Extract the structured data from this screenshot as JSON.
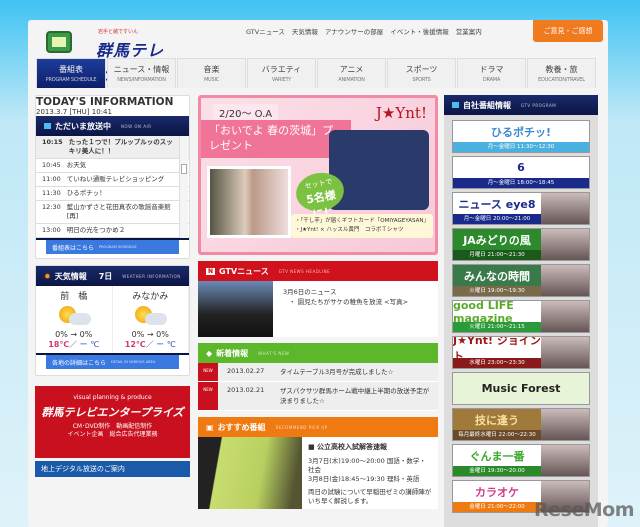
{
  "header": {
    "logo_tag": "岩手と緒ですいん",
    "logo": "群馬テレビ",
    "links": [
      "GTVニュース",
      "天気情報",
      "アナウンサーの部屋",
      "イベント・後援情報",
      "営業案内"
    ],
    "opinion": "ご意見・ご感想"
  },
  "nav": [
    {
      "label": "番組表",
      "sub": "PROGRAM SCHEDULE"
    },
    {
      "label": "ニュース・情報",
      "sub": "NEWS/INFORMATION"
    },
    {
      "label": "音楽",
      "sub": "MUSIC"
    },
    {
      "label": "バラエティ",
      "sub": "VARIETY"
    },
    {
      "label": "アニメ",
      "sub": "ANIMATION"
    },
    {
      "label": "スポーツ",
      "sub": "SPORTS"
    },
    {
      "label": "ドラマ",
      "sub": "DRAMA"
    },
    {
      "label": "教養・旅",
      "sub": "EDUCATION/TRAVEL"
    }
  ],
  "today": {
    "title": "TODAY'S INFORMATION",
    "date": "2013.3.7 [THU] 10:41"
  },
  "onair": {
    "title": "ただいま放送中",
    "sub": "NOW ON AIR",
    "rows": [
      {
        "time": "10:15",
        "title": "たった１つで！プルップルッのスッキリ美人に！！"
      },
      {
        "time": "10:45",
        "title": "お天気"
      },
      {
        "time": "11:00",
        "title": "ていねい通販テレビショッピング"
      },
      {
        "time": "11:30",
        "title": "ひるポチッ！"
      },
      {
        "time": "12:30",
        "title": "藍山かずさと花田真衣の歌謡音楽館[再]"
      },
      {
        "time": "13:00",
        "title": "明日の光をつかめ２"
      }
    ],
    "more": "番組表はこちら",
    "more_sub": "PROGRAM SCHEDULE"
  },
  "weather": {
    "title": "天気情報",
    "day": "7日",
    "sub": "WEATHER INFORMATION",
    "cities": [
      {
        "name": "前　橋",
        "pct": "0% → 0%",
        "hi": "18℃",
        "lo": "／ ー ℃"
      },
      {
        "name": "みなかみ",
        "pct": "0% → 0%",
        "hi": "12℃",
        "lo": "／ ー ℃"
      }
    ],
    "more": "各地の詳細はこちら",
    "more_sub": "DETAIL IN VARIOUS AREA"
  },
  "banners": {
    "ent_a": "visual planning & produce",
    "ent_b": "群馬テレビエンタープライズ",
    "ent_c1": "CM･DVD制作　動画配信制作",
    "ent_c2": "イベント企画　総合広告代理業務",
    "digital": "地上デジタル放送のご案内"
  },
  "promo": {
    "oa": "2/20～ O.A",
    "title": "「おいでよ 春の茨城」プレゼント",
    "brand": "J★Ynt!",
    "set1": "セットで",
    "set2": "5名様に！",
    "note1": "・「干し芋」が届くギフトカード「OMIYAGEYASAN」",
    "note2": "・J★Ynt! × ハッスル黄門　コラボＴシャツ"
  },
  "gtvnews": {
    "title": "GTVニュース",
    "sub": "GTV NEWS HEADLINE",
    "date": "3月6日のニュース",
    "item": "・ 園児たちがサケの稚魚を放流 <写真>"
  },
  "whatsnew": {
    "title": "新着情報",
    "sub": "WHAT'S NEW",
    "badge": "NEW",
    "items": [
      {
        "date": "2013.02.27",
        "text": "タイムテーブル3月号が完成しました☆"
      },
      {
        "date": "2013.02.21",
        "text": "ザスパクサツ群馬ホーム戦中継上半期の放送予定が決まりました☆"
      }
    ]
  },
  "recommend": {
    "title": "おすすめ番組",
    "sub": "RECOMMEND PICK UP",
    "head": "■ 公立高校入試解答速報",
    "l1": "3月7日(木)19:00～20:00 国語・数学・社会",
    "l2": "3月8日(金)18:45～19:30 理科・英語",
    "l3": "両日の試験について早稲田ゼミの講師陣がいち早く解説します。"
  },
  "gtvprogram": {
    "title": "自社番組情報",
    "sub": "GTV PROGRAM",
    "items": [
      {
        "logo": "ひるポチッ!",
        "when": "月～金曜日 11:30～12:30",
        "color": "#4ab0e0",
        "fg": "#3a8ad0"
      },
      {
        "logo": "6",
        "when": "月～金曜日 18:00～18:45",
        "color": "#1a2a8a",
        "fg": "#1a2a8a"
      },
      {
        "logo": "ニュース eye8",
        "when": "月～金曜日 20:00～21:00",
        "color": "#1a2a8a",
        "fg": "#1a2a8a",
        "img": true
      },
      {
        "logo": "JAみどりの風",
        "when": "月曜日 21:00～21:30",
        "color": "#1a5a1a",
        "fg": "#fff",
        "bg": "#2c8a2c",
        "img": true
      },
      {
        "logo": "みんなの時間",
        "when": "火曜日 19:00～19:30",
        "color": "#7a6a4a",
        "fg": "#fff",
        "bg": "#3a7a4a",
        "img": true
      },
      {
        "logo": "good LIFE magazine",
        "when": "火曜日 21:00～21:15",
        "color": "#2a9a3a",
        "fg": "#5aaa2a",
        "img": true
      },
      {
        "logo": "J★Ynt! ジョイント",
        "when": "水曜日 23:00～23:30",
        "color": "#8a1a1a",
        "fg": "#a01818",
        "img": true
      },
      {
        "logo": "Music Forest",
        "when": "",
        "color": "",
        "fg": "#222",
        "bg": "#e8f4d8"
      },
      {
        "logo": "技に逢う",
        "when": "毎月最終水曜日 22:00～22:30",
        "color": "#6a4a2a",
        "fg": "#f8e0a0",
        "bg": "#a07a3a",
        "img": true
      },
      {
        "logo": "ぐんま一番",
        "when": "金曜日 19:30～20:00",
        "color": "#2a8a2a",
        "fg": "#3aaa2a",
        "img": true
      },
      {
        "logo": "カラオケ",
        "when": "金曜日 21:00～22:00",
        "color": "#f07a12",
        "fg": "#d03a8a",
        "img": true
      }
    ]
  },
  "watermark": "ReseMom"
}
